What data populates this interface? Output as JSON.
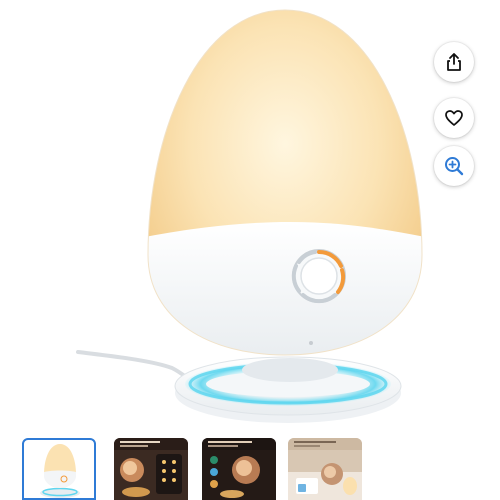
{
  "product_image": {
    "icon": "egg-night-lamp-image",
    "glow_color": "#f8d9a0",
    "ring_color": "#5fd6ef",
    "accent_color": "#f39a3a"
  },
  "actions": [
    {
      "icon": "share-icon"
    },
    {
      "icon": "heart-icon"
    },
    {
      "icon": "zoom-icon"
    }
  ],
  "thumbnails": {
    "selected_index": 0,
    "count": 4,
    "selected_border_color": "#2f7bd6"
  }
}
